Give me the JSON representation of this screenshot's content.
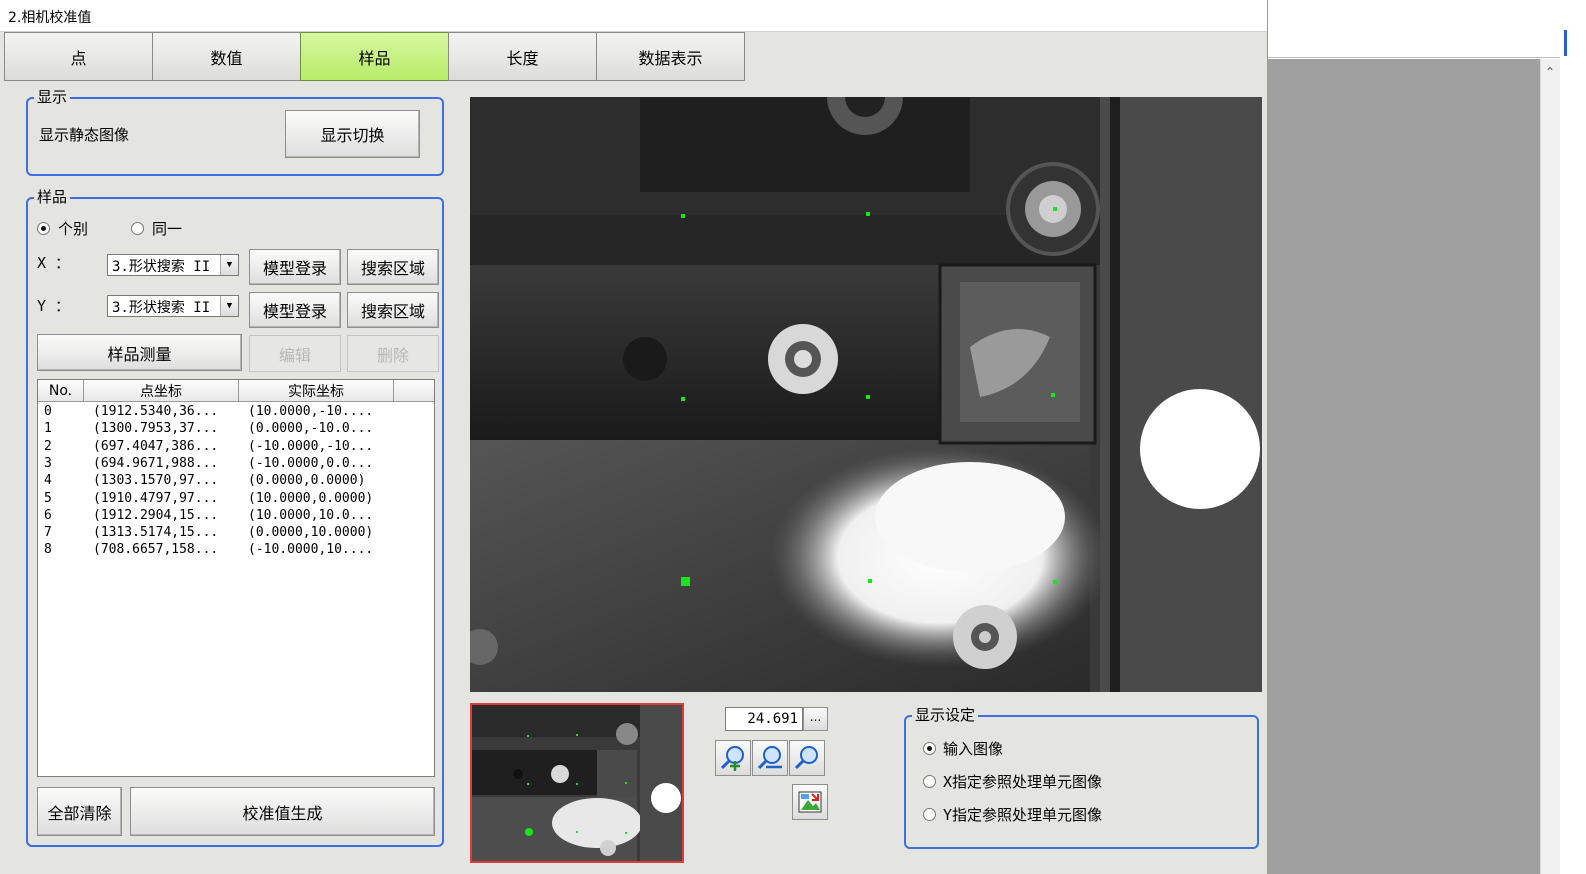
{
  "window": {
    "title": "2.相机校准值"
  },
  "tabs": [
    {
      "label": "点"
    },
    {
      "label": "数值"
    },
    {
      "label": "样品"
    },
    {
      "label": "长度"
    },
    {
      "label": "数据表示"
    }
  ],
  "display_group": {
    "legend": "显示",
    "text": "显示静态图像",
    "switch_button": "显示切换"
  },
  "sample_group": {
    "legend": "样品",
    "radio_individual": "个别",
    "radio_same": "同一",
    "x_label": "X ：",
    "y_label": "Y ：",
    "x_select": "3.形状搜索 II",
    "y_select": "3.形状搜索 II",
    "model_register": "模型登录",
    "search_area": "搜索区域",
    "measure_button": "样品测量",
    "edit_button": "编辑",
    "delete_button": "删除",
    "clear_all_button": "全部清除",
    "generate_button": "校准值生成"
  },
  "table": {
    "columns": [
      "No.",
      "点坐标",
      "实际坐标"
    ],
    "rows": [
      {
        "no": "0",
        "point": "(1912.5340,36...",
        "actual": "(10.0000,-10...."
      },
      {
        "no": "1",
        "point": "(1300.7953,37...",
        "actual": "(0.0000,-10.0..."
      },
      {
        "no": "2",
        "point": "(697.4047,386...",
        "actual": "(-10.0000,-10..."
      },
      {
        "no": "3",
        "point": "(694.9671,988...",
        "actual": "(-10.0000,0.0..."
      },
      {
        "no": "4",
        "point": "(1303.1570,97...",
        "actual": "(0.0000,0.0000)"
      },
      {
        "no": "5",
        "point": "(1910.4797,97...",
        "actual": "(10.0000,0.0000)"
      },
      {
        "no": "6",
        "point": "(1912.2904,15...",
        "actual": "(10.0000,10.0..."
      },
      {
        "no": "7",
        "point": "(1313.5174,15...",
        "actual": "(0.0000,10.0000)"
      },
      {
        "no": "8",
        "point": "(708.6657,158...",
        "actual": "(-10.0000,10...."
      }
    ]
  },
  "zoom": {
    "value": "24.691",
    "more_button": "..."
  },
  "display_settings": {
    "legend": "显示设定",
    "options": [
      "输入图像",
      "X指定参照处理单元图像",
      "Y指定参照处理单元图像"
    ],
    "selected_index": 0
  },
  "colors": {
    "accent_border": "#3d6fe0",
    "active_tab": "#b9ec6a",
    "marker": "#19e619",
    "thumb_border": "#e03a3a"
  }
}
